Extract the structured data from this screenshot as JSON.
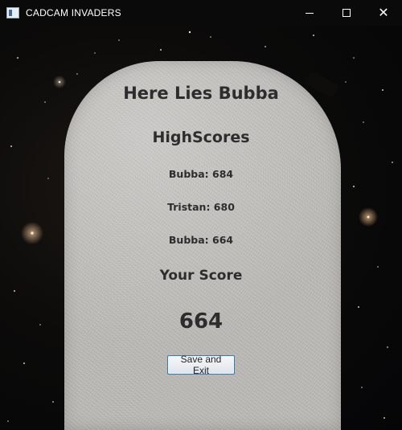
{
  "window": {
    "title": "CADCAM INVADERS",
    "controls": [
      "minimize",
      "maximize",
      "close"
    ],
    "close_glyph": "✕"
  },
  "gravestone": {
    "epitaph": "Here Lies Bubba",
    "highscores_heading": "HighScores",
    "highscores": [
      "Bubba: 684",
      "Tristan: 680",
      "Bubba: 664"
    ],
    "your_score_heading": "Your Score",
    "your_score_value": "664",
    "save_button_label": "Save and Exit"
  },
  "colors": {
    "stone": "#bdbcb8",
    "text": "#2d2d2d",
    "sky": "#05060a",
    "button_border": "#2c7ad6"
  }
}
